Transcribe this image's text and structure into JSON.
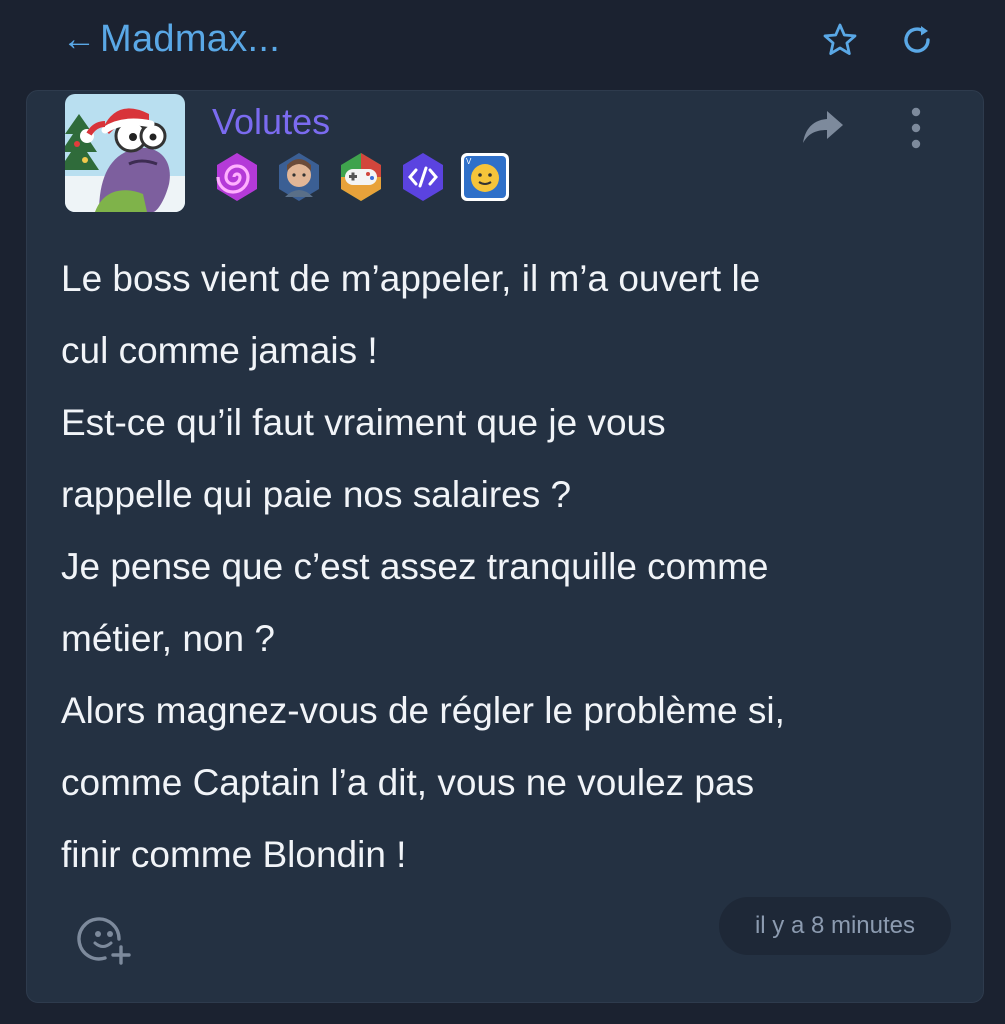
{
  "header": {
    "back_title": "Madmax...",
    "icons": [
      "arrow-left-icon",
      "star-icon",
      "refresh-icon"
    ],
    "accent_color": "#5aa8e6"
  },
  "post": {
    "author": "Volutes",
    "author_color": "#7b6bf0",
    "badges": [
      "spiral-badge",
      "portrait-badge",
      "gamepad-badge",
      "code-badge",
      "smiley-card-badge"
    ],
    "message_lines": [
      "Le boss vient de m’appeler, il m’a ouvert le",
      "cul comme jamais !",
      "Est-ce qu’il faut vraiment que je vous",
      "rappelle qui paie nos salaires ?",
      "Je pense que c’est assez tranquille comme",
      "métier, non ?",
      "Alors magnez-vous de régler le problème si,",
      "comme Captain l’a dit, vous ne voulez pas",
      "finir comme Blondin !"
    ],
    "timestamp": "il y a 8 minutes"
  }
}
